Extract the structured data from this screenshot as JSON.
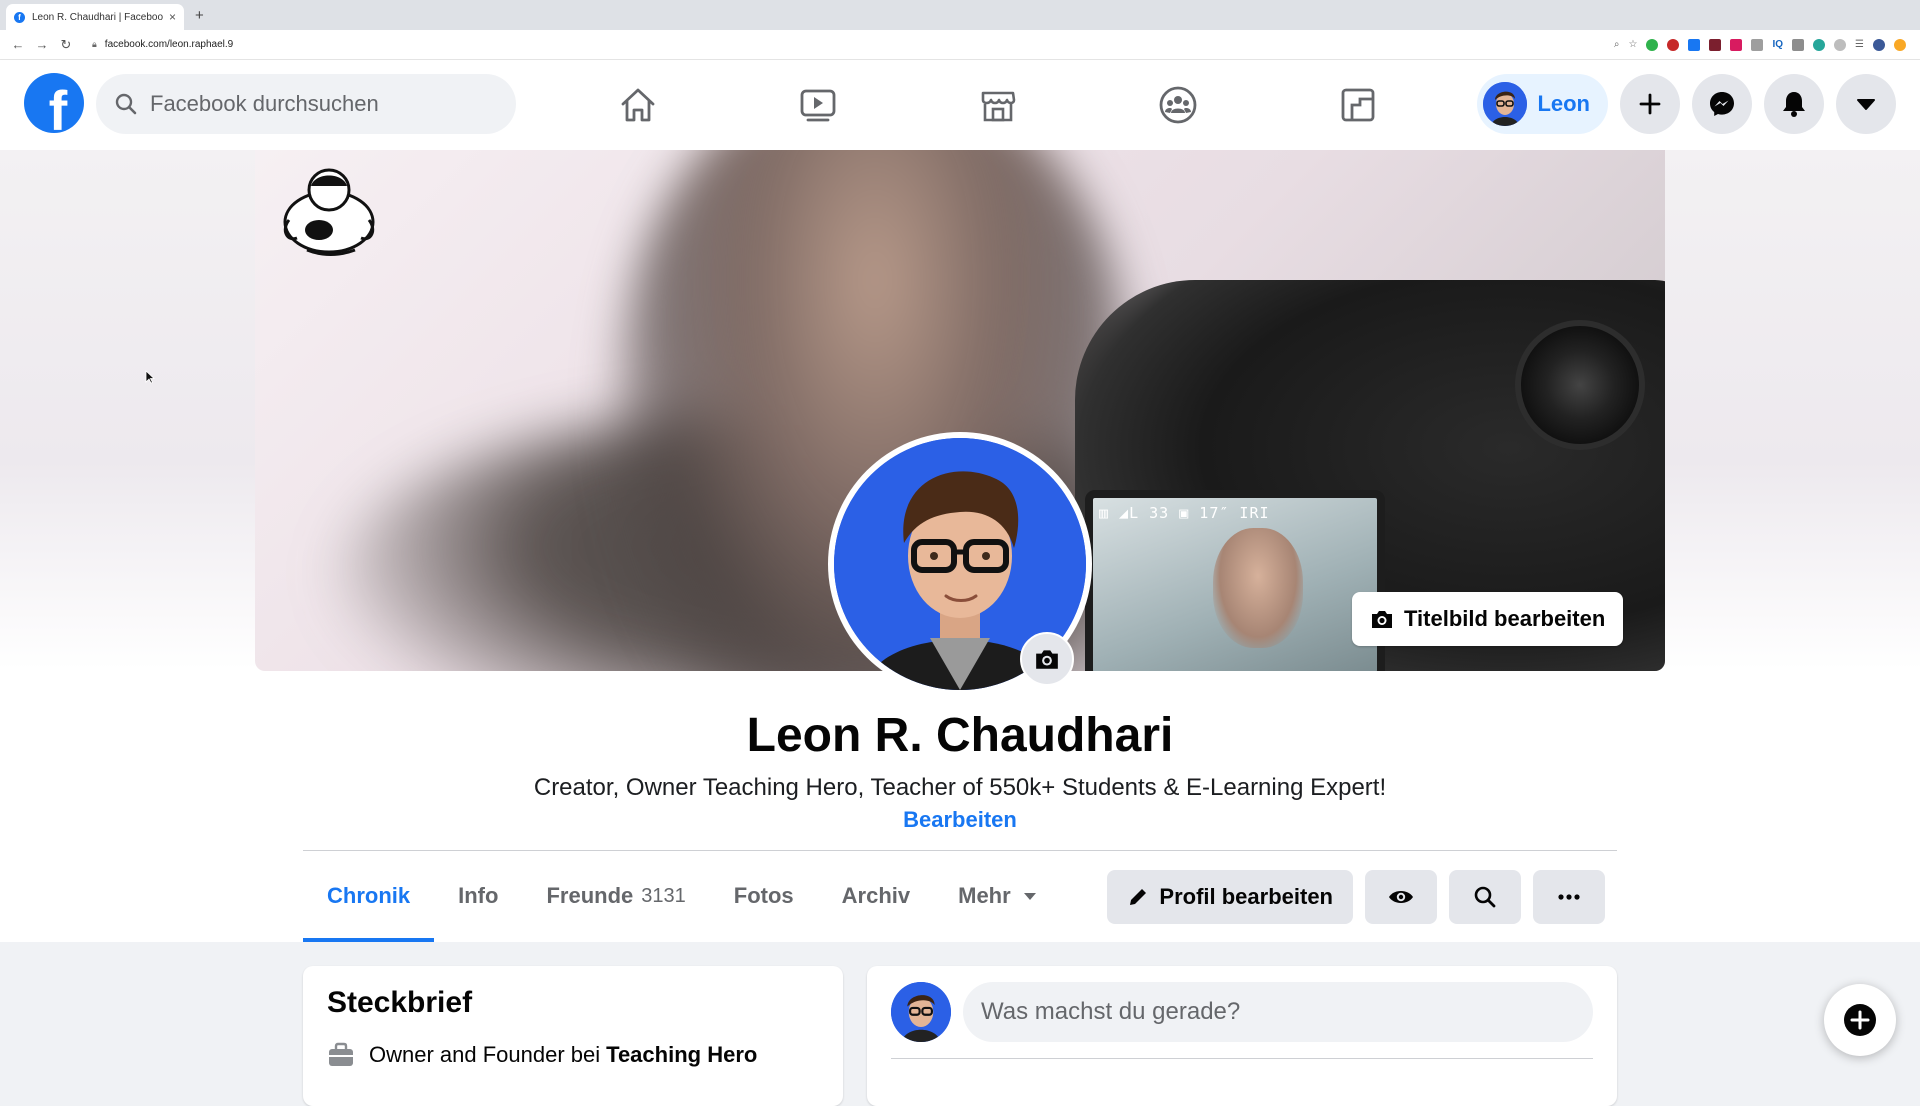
{
  "browser": {
    "tab_title": "Leon R. Chaudhari | Facebook",
    "tab_close": "×",
    "new_tab": "+",
    "url": "facebook.com/leon.raphael.9"
  },
  "header": {
    "logo_letter": "f",
    "search_placeholder": "Facebook durchsuchen",
    "user_name": "Leon",
    "brand_color": "#1877f2",
    "nav_icons": [
      "home-icon",
      "watch-icon",
      "marketplace-icon",
      "groups-icon",
      "gaming-icon"
    ],
    "right_icons": [
      "plus-icon",
      "messenger-icon",
      "notifications-icon",
      "account-menu-icon"
    ]
  },
  "cover": {
    "osd_text": "▥ ◢L 33 ▣ 17″ IRI",
    "edit_label": "Titelbild bearbeiten"
  },
  "profile": {
    "name": "Leon R. Chaudhari",
    "bio": "Creator, Owner Teaching Hero, Teacher of 550k+ Students & E-Learning Expert!",
    "bio_edit": "Bearbeiten"
  },
  "tabs": [
    {
      "label": "Chronik",
      "active": true
    },
    {
      "label": "Info"
    },
    {
      "label": "Freunde",
      "count": "3131"
    },
    {
      "label": "Fotos"
    },
    {
      "label": "Archiv"
    },
    {
      "label": "Mehr"
    }
  ],
  "actions": {
    "edit_profile": "Profil bearbeiten"
  },
  "steckbrief": {
    "title": "Steckbrief",
    "work_prefix": "Owner and Founder bei",
    "work_company": "Teaching Hero"
  },
  "composer": {
    "placeholder": "Was machst du gerade?"
  }
}
